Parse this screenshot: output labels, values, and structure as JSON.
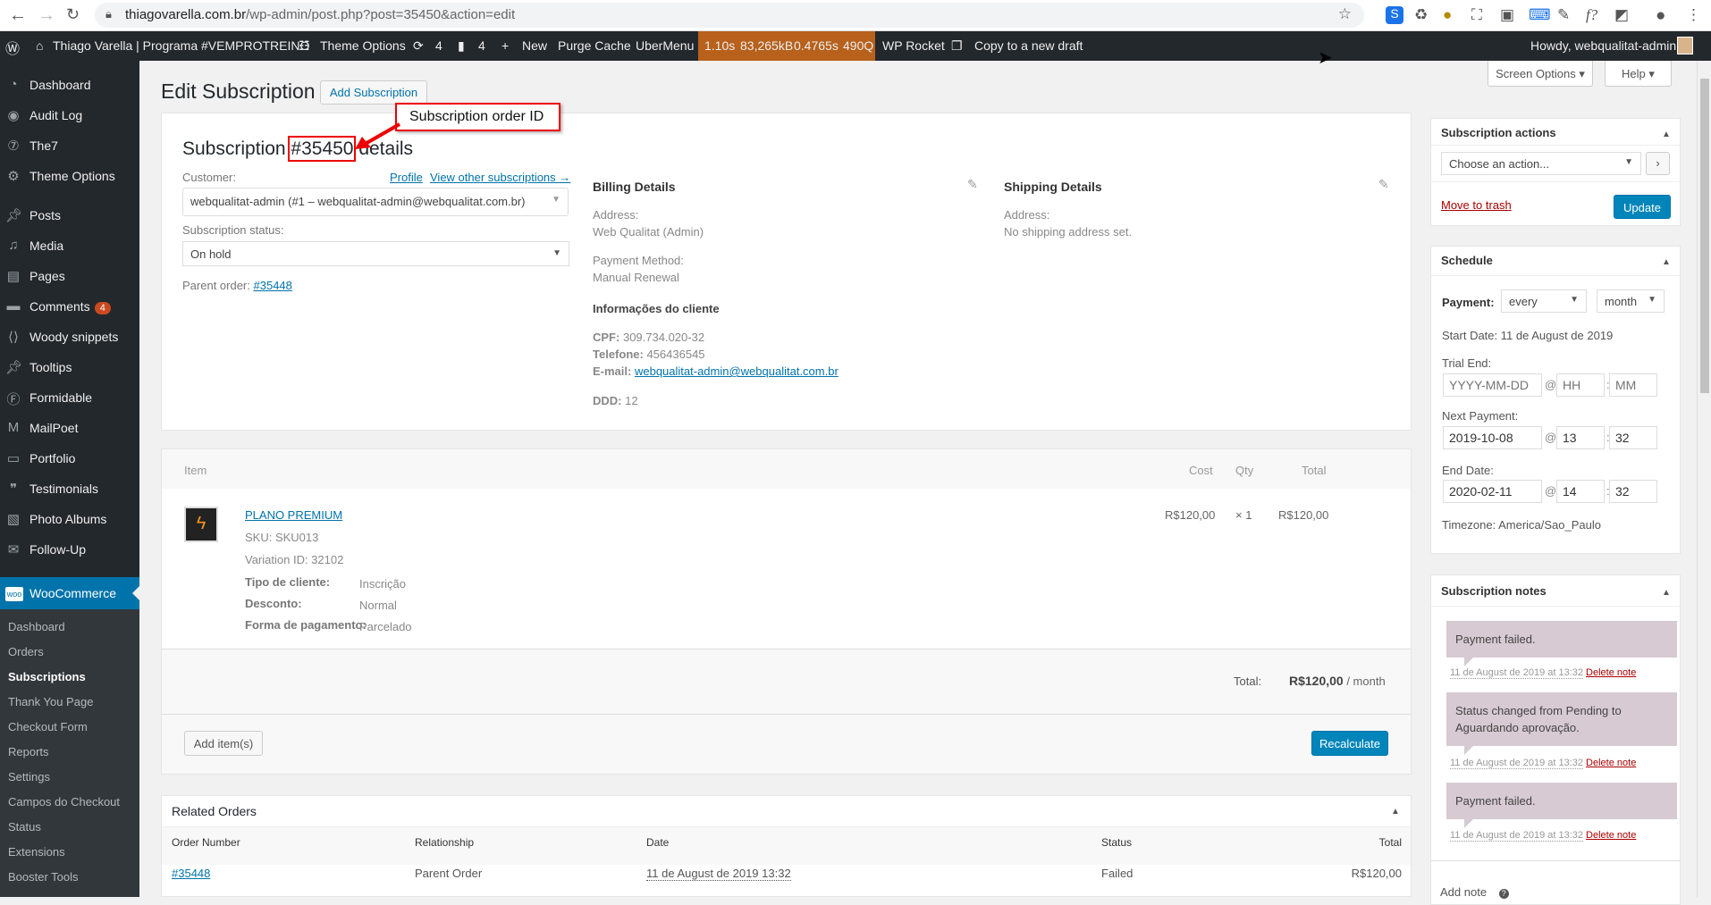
{
  "browser": {
    "url_host": "thiagovarella.com.br",
    "url_path": "/wp-admin/post.php?post=35450&action=edit"
  },
  "adminbar": {
    "site": "Thiago Varella | Programa #VEMPROTREINO",
    "theme_options": "Theme Options",
    "updates": "4",
    "comments": "4",
    "new": "New",
    "purge": "Purge Cache",
    "ubermenu": "UberMenu",
    "perf": [
      "1.10s",
      "83,265kB",
      "0.4765s",
      "490Q"
    ],
    "wprocket": "WP Rocket",
    "copy": "Copy to a new draft",
    "howdy": "Howdy, webqualitat-admin"
  },
  "sidebar": {
    "items": [
      {
        "label": "Dashboard",
        "icon": "dashboard-icon"
      },
      {
        "label": "Audit Log",
        "icon": "shield-icon"
      },
      {
        "label": "The7",
        "icon": "the7-icon"
      },
      {
        "label": "Theme Options",
        "icon": "gear-icon"
      },
      {
        "label": "Posts",
        "icon": "pin-icon"
      },
      {
        "label": "Media",
        "icon": "media-icon"
      },
      {
        "label": "Pages",
        "icon": "pages-icon"
      },
      {
        "label": "Comments",
        "icon": "comment-icon",
        "badge": "4"
      },
      {
        "label": "Woody snippets",
        "icon": "snippet-icon"
      },
      {
        "label": "Tooltips",
        "icon": "pin-icon"
      },
      {
        "label": "Formidable",
        "icon": "formidable-icon"
      },
      {
        "label": "MailPoet",
        "icon": "mailpoet-icon"
      },
      {
        "label": "Portfolio",
        "icon": "briefcase-icon"
      },
      {
        "label": "Testimonials",
        "icon": "quote-icon"
      },
      {
        "label": "Photo Albums",
        "icon": "album-icon"
      },
      {
        "label": "Follow-Up",
        "icon": "mail-icon"
      }
    ],
    "woocommerce": "WooCommerce",
    "submenu": [
      "Dashboard",
      "Orders",
      "Subscriptions",
      "Thank You Page",
      "Checkout Form",
      "Reports",
      "Settings",
      "Campos do Checkout",
      "Status",
      "Extensions",
      "Booster Tools"
    ]
  },
  "page": {
    "title": "Edit Subscription",
    "add_button": "Add Subscription",
    "screen_options": "Screen Options",
    "help": "Help",
    "annotation": "Subscription order ID"
  },
  "details": {
    "heading_pre": "Subscription ",
    "heading_id": "#35450",
    "heading_post": " details",
    "customer_label": "Customer:",
    "profile": "Profile",
    "view_other": "View other subscriptions →",
    "customer_value": "webqualitat-admin (#1 – webqualitat-admin@webqualitat.com.br)",
    "status_label": "Subscription status:",
    "status_value": "On hold",
    "parent_label": "Parent order: ",
    "parent_link": "#35448"
  },
  "billing": {
    "heading": "Billing Details",
    "address_label": "Address:",
    "address": "Web Qualitat (Admin)",
    "pm_label": "Payment Method:",
    "pm": "Manual Renewal",
    "info_heading": "Informações do cliente",
    "cpf_label": "CPF:",
    "cpf": "309.734.020-32",
    "tel_label": "Telefone:",
    "tel": "456436545",
    "email_label": "E-mail:",
    "email": "webqualitat-admin@webqualitat.com.br",
    "ddd_label": "DDD:",
    "ddd": "12"
  },
  "shipping": {
    "heading": "Shipping Details",
    "address_label": "Address:",
    "address": "No shipping address set."
  },
  "items": {
    "headers": {
      "item": "Item",
      "cost": "Cost",
      "qty": "Qty",
      "total": "Total"
    },
    "row": {
      "name": "PLANO PREMIUM",
      "sku": "SKU: SKU013",
      "variation": "Variation ID: 32102",
      "meta": [
        {
          "k": "Tipo de cliente:",
          "v": "Inscrição"
        },
        {
          "k": "Desconto:",
          "v": "Normal"
        },
        {
          "k": "Forma de pagamento:",
          "v": "Parcelado"
        }
      ],
      "cost": "R$120,00",
      "qty": "× 1",
      "total": "R$120,00"
    },
    "total_label": "Total:",
    "total_value": "R$120,00",
    "total_period": " / month",
    "add_items": "Add item(s)",
    "recalculate": "Recalculate"
  },
  "related": {
    "title": "Related Orders",
    "headers": [
      "Order Number",
      "Relationship",
      "Date",
      "Status",
      "Total"
    ],
    "rows": [
      {
        "order": "#35448",
        "relationship": "Parent Order",
        "date": "11 de August de 2019 13:32",
        "status": "Failed",
        "total": "R$120,00"
      }
    ]
  },
  "actions": {
    "title": "Subscription actions",
    "select": "Choose an action...",
    "trash": "Move to trash",
    "update": "Update"
  },
  "schedule": {
    "title": "Schedule",
    "payment_label": "Payment:",
    "interval": "every",
    "period": "month",
    "start": "Start Date: 11 de August de 2019",
    "trial_label": "Trial End:",
    "trial_date_ph": "YYYY-MM-DD",
    "hh_ph": "HH",
    "mm_ph": "MM",
    "next_label": "Next Payment:",
    "next_date": "2019-10-08",
    "next_h": "13",
    "next_m": "32",
    "end_label": "End Date:",
    "end_date": "2020-02-11",
    "end_h": "14",
    "end_m": "32",
    "timezone": "Timezone: America/Sao_Paulo"
  },
  "notes": {
    "title": "Subscription notes",
    "items": [
      {
        "text": "Payment failed.",
        "date": "11 de August de 2019 at 13:32",
        "del": "Delete note"
      },
      {
        "text": "Status changed from Pending to Aguardando aprovação.",
        "date": "11 de August de 2019 at 13:32",
        "del": "Delete note"
      },
      {
        "text": "Payment failed.",
        "date": "11 de August de 2019 at 13:32",
        "del": "Delete note"
      }
    ],
    "add_note": "Add note"
  }
}
